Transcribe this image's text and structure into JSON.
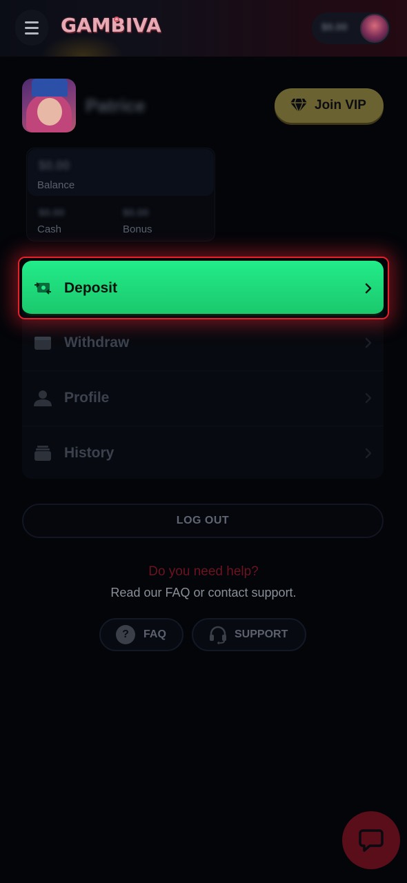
{
  "header": {
    "logo_text": "GAMBIVA",
    "wallet_amount": "$0.00"
  },
  "profile": {
    "username": "Patrice",
    "vip_label": "Join VIP"
  },
  "balance": {
    "amount": "$0.00",
    "label": "Balance",
    "cash_amount": "$0.00",
    "cash_label": "Cash",
    "bonus_amount": "$0.00",
    "bonus_label": "Bonus"
  },
  "menu": {
    "items": [
      {
        "label": "Deposit",
        "icon": "money-transfer-icon"
      },
      {
        "label": "Withdraw",
        "icon": "wallet-icon"
      },
      {
        "label": "Profile",
        "icon": "person-icon"
      },
      {
        "label": "History",
        "icon": "history-stack-icon"
      }
    ]
  },
  "logout_label": "LOG OUT",
  "help": {
    "title": "Do you need help?",
    "subtitle": "Read our FAQ or contact support.",
    "faq_label": "FAQ",
    "support_label": "SUPPORT"
  },
  "colors": {
    "deposit_green": "#22ec8a",
    "highlight_red": "#e5222c",
    "vip_gold": "#6b6231",
    "help_red": "#6c1322",
    "background": "#030509"
  }
}
